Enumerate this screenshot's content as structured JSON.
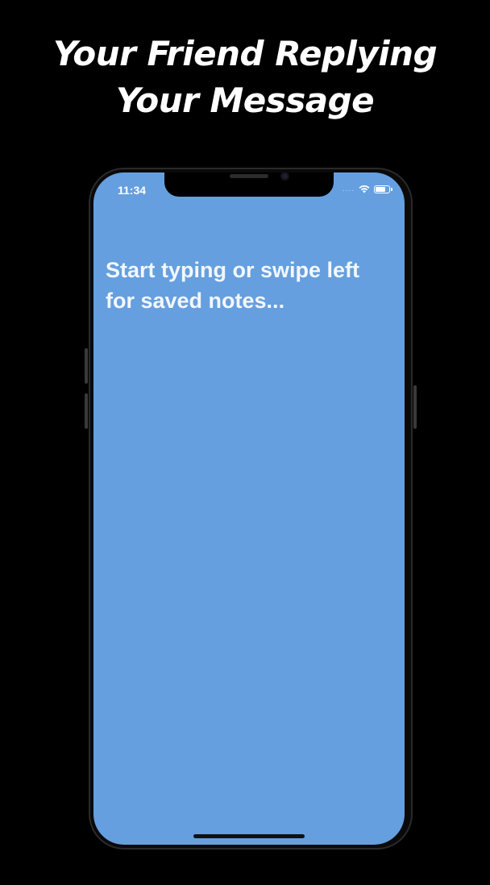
{
  "headline": {
    "line1": "Your Friend Replying",
    "line2": "Your Message"
  },
  "status_bar": {
    "time": "11:34",
    "signal_dots": "....",
    "wifi_icon": "wifi-icon",
    "battery_icon": "battery-icon",
    "battery_level": 0.75
  },
  "note_editor": {
    "placeholder": "Start typing or swipe left\nfor saved notes..."
  },
  "colors": {
    "screen_background": "#659fdf",
    "page_background": "#000000",
    "text": "#ffffff"
  }
}
